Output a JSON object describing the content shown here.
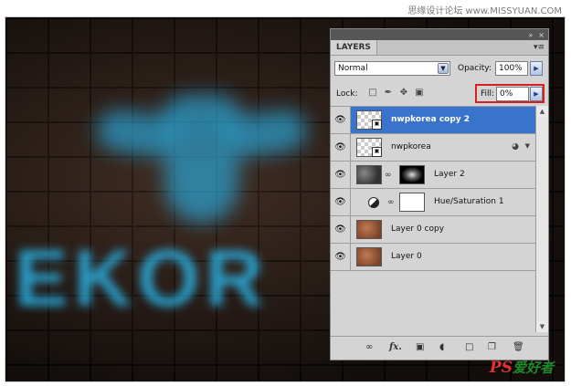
{
  "watermarks": {
    "top_right": "思缘设计论坛 www.MISSYUAN.COM",
    "bottom_right_ps": "PS",
    "bottom_right_text": "爱好者"
  },
  "canvas": {
    "neon_text": "EKOR"
  },
  "panel": {
    "tab_label": "LAYERS",
    "collapse_icon": "double-chevron-right-icon",
    "close_icon": "close-icon",
    "menu_icon": "panel-menu-icon",
    "blend_mode": "Normal",
    "opacity_label": "Opacity:",
    "opacity_value": "100%",
    "lock_label": "Lock:",
    "fill_label": "Fill:",
    "fill_value": "0%",
    "highlight_color": "#d61f1f",
    "selected_color": "#3a73cc"
  },
  "layers": [
    {
      "name": "nwpkorea copy 2",
      "selected": true,
      "thumb": "checker-smart"
    },
    {
      "name": "nwpkorea",
      "selected": false,
      "thumb": "checker-smart",
      "has_fx": true
    },
    {
      "name": "Layer 2",
      "selected": false,
      "thumb": "stone-with-mask"
    },
    {
      "name": "Hue/Saturation 1",
      "selected": false,
      "thumb": "adjustment-white-mask"
    },
    {
      "name": "Layer 0 copy",
      "selected": false,
      "thumb": "copper"
    },
    {
      "name": "Layer 0",
      "selected": false,
      "thumb": "copper"
    }
  ],
  "bottom_icons": [
    "link-layers-icon",
    "fx-icon",
    "add-mask-icon",
    "adjustment-layer-icon",
    "new-group-icon",
    "new-layer-icon",
    "trash-icon"
  ]
}
